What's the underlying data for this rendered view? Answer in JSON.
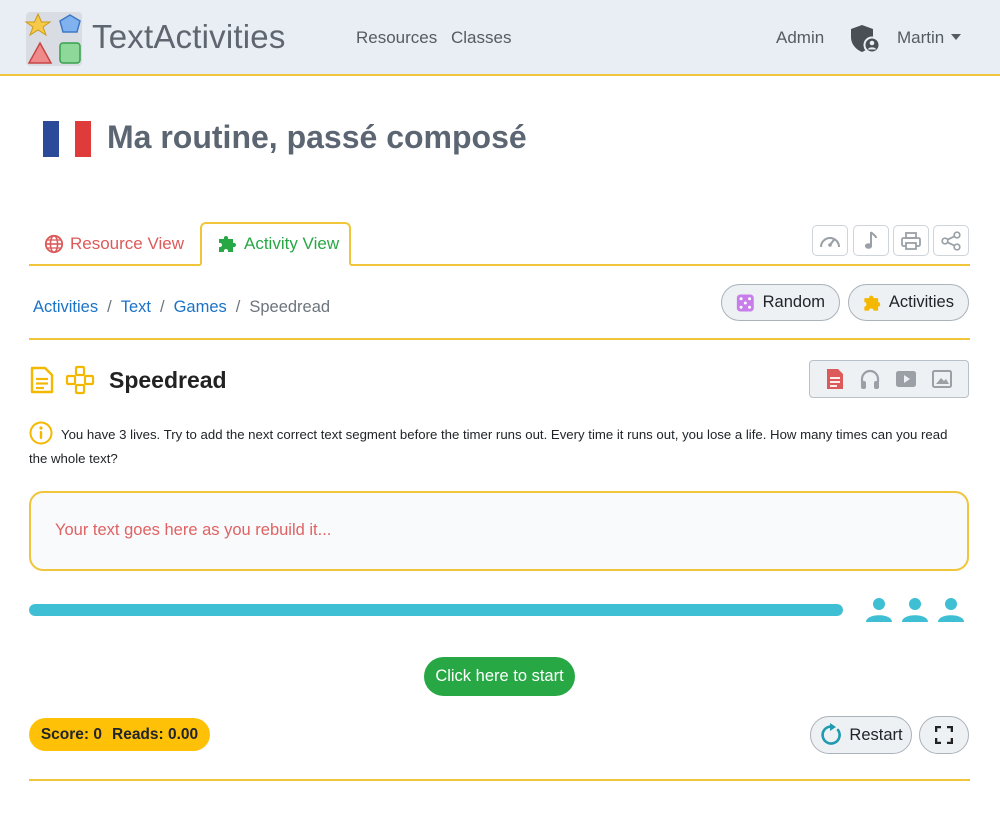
{
  "header": {
    "brand": "TextActivities",
    "nav": {
      "resources": "Resources",
      "classes": "Classes",
      "admin": "Admin",
      "user": "Martin"
    }
  },
  "page": {
    "title": "Ma routine, passé composé",
    "flag_colors": [
      "#2b4a9a",
      "#ffffff",
      "#e03b3b"
    ]
  },
  "tabs": {
    "resource_view": "Resource View",
    "activity_view": "Activity View",
    "active": "activity_view",
    "tools": [
      "speedometer-icon",
      "music-note-icon",
      "printer-icon",
      "share-icon"
    ]
  },
  "breadcrumb": {
    "items": [
      "Activities",
      "Text",
      "Games"
    ],
    "current": "Speedread"
  },
  "actions": {
    "random": "Random",
    "activities": "Activities"
  },
  "activity": {
    "title": "Speedread",
    "instructions": "You have 3 lives. Try to add the next correct text segment before the timer runs out. Every time it runs out, you lose a life. How many times can you read the whole text?",
    "placeholder": "Your text goes here as you rebuild it...",
    "timer_progress": 1.0,
    "lives": 3,
    "media": [
      "document-icon",
      "headphones-icon",
      "video-icon",
      "image-icon"
    ]
  },
  "controls": {
    "start": "Click here to start",
    "score_label": "Score: 0",
    "reads_label": "Reads: 0.00",
    "restart": "Restart"
  },
  "colors": {
    "accent": "#f0c53a",
    "success": "#28a745",
    "danger": "#dc5a5a",
    "link": "#1a73c8",
    "info": "#3ebfd3",
    "warning": "#ffc107"
  }
}
